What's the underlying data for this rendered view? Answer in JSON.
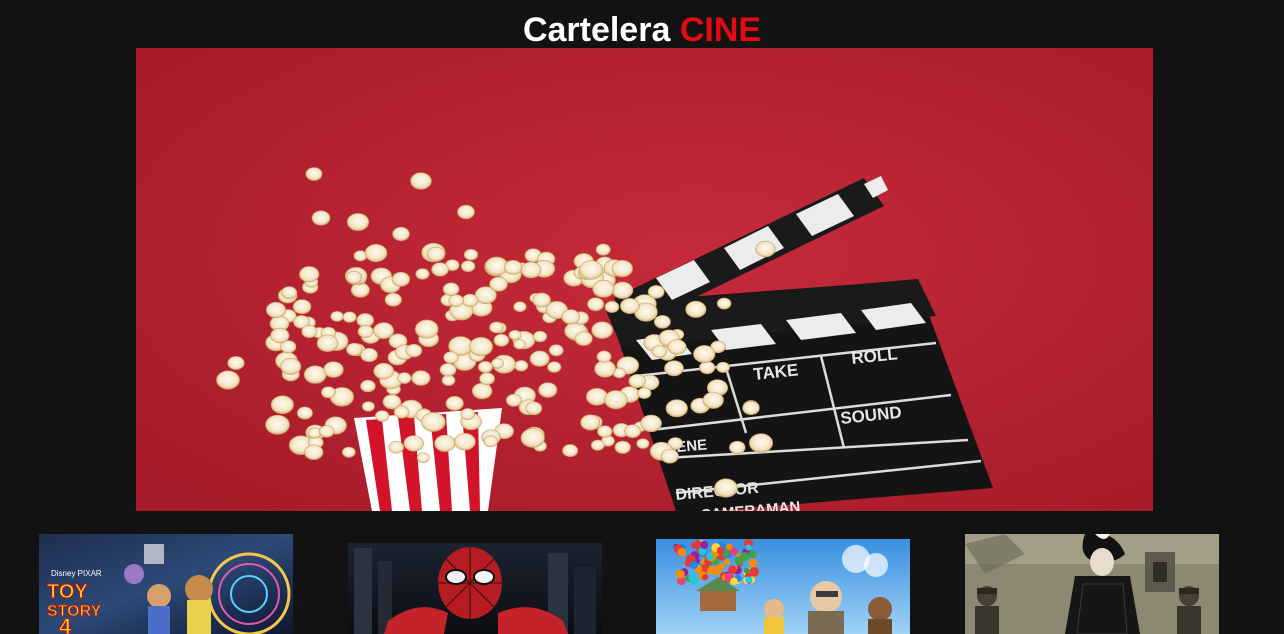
{
  "header": {
    "title_main": "Cartelera",
    "title_accent": "CINE",
    "accent_color": "#e50914"
  },
  "hero": {
    "clapper_labels": {
      "take": "TAKE",
      "roll": "ROLL",
      "sound": "SOUND",
      "director": "DIRECTOR",
      "scene": "SCENE",
      "cameraman": "CAMERAMAN"
    }
  },
  "posters": [
    {
      "id": "toy-story-4",
      "brand": "Disney PIXAR",
      "title_line1": "TOY",
      "title_line2": "STORY",
      "title_number": "4"
    },
    {
      "id": "spider-man"
    },
    {
      "id": "up"
    },
    {
      "id": "cruella"
    }
  ]
}
